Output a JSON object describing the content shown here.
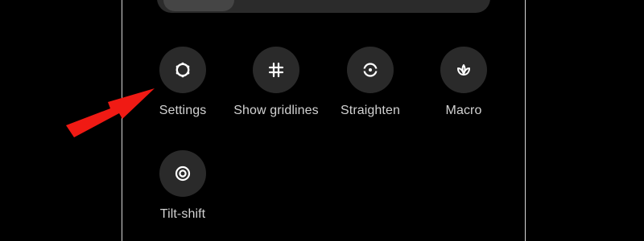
{
  "settings_grid": {
    "items": [
      {
        "label": "Settings",
        "icon": "gear-icon"
      },
      {
        "label": "Show gridlines",
        "icon": "grid-icon"
      },
      {
        "label": "Straighten",
        "icon": "level-icon"
      },
      {
        "label": "Macro",
        "icon": "flower-icon"
      },
      {
        "label": "Tilt-shift",
        "icon": "target-icon"
      }
    ]
  },
  "annotation": {
    "arrow_color": "#f01a14"
  },
  "colors": {
    "background": "#000000",
    "button": "#2a2a2a",
    "label": "#d2d2d2",
    "icon": "#ffffff"
  }
}
